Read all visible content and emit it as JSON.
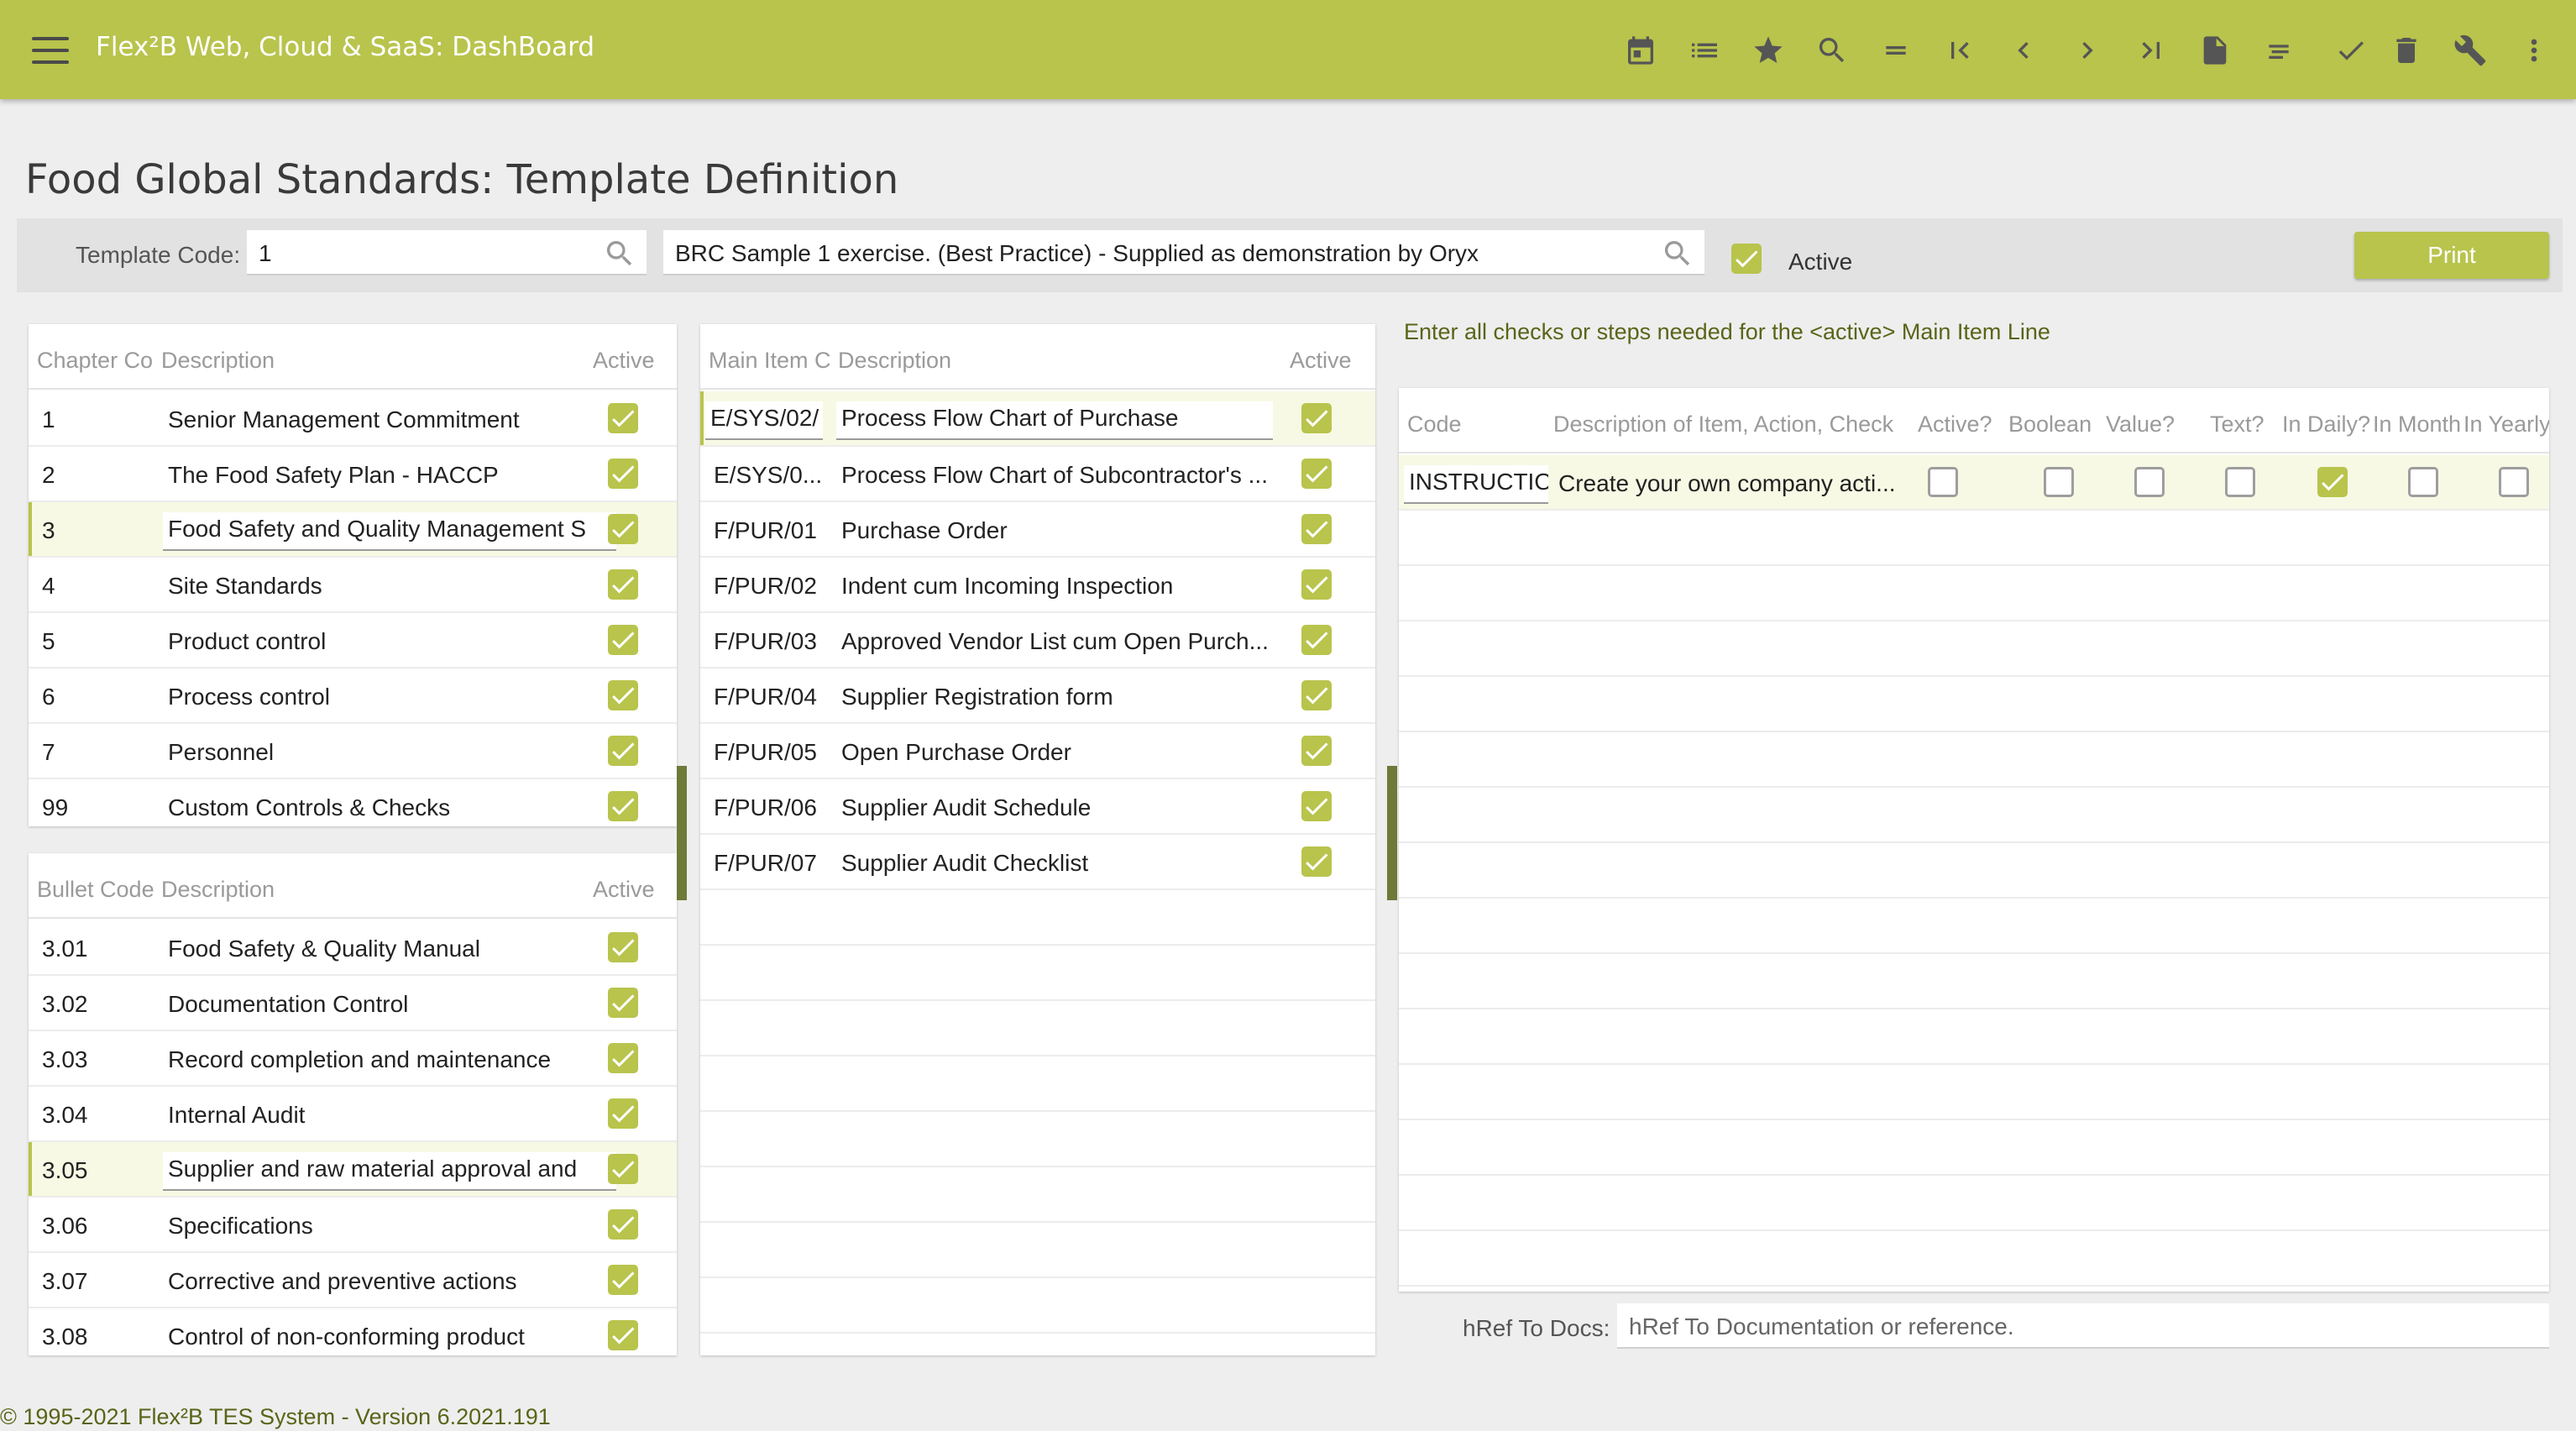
{
  "app": {
    "title": "Flex²B Web, Cloud & SaaS: DashBoard",
    "page_title": "Food Global Standards: Template Definition",
    "footer": "© 1995-2021 Flex²B TES System - Version 6.2021.191",
    "accent_color": "#b8c44c"
  },
  "toolbar": {
    "icons": [
      "calendar-icon",
      "list-icon",
      "star-icon",
      "search-icon",
      "equals-icon",
      "first-page-icon",
      "previous-icon",
      "next-icon",
      "last-page-icon",
      "document-icon",
      "notes-icon",
      "check-icon",
      "delete-icon",
      "wrench-icon",
      "more-vert-icon"
    ]
  },
  "filter": {
    "template_code_label": "Template Code:",
    "template_code_value": "1",
    "description_value": "BRC Sample 1 exercise. (Best Practice) - Supplied as demonstration by Oryx",
    "active_label": "Active",
    "active_checked": true,
    "print_label": "Print"
  },
  "chapters": {
    "headers": {
      "code": "Chapter Co",
      "desc": "Description",
      "active": "Active"
    },
    "rows": [
      {
        "code": "1",
        "desc": "Senior Management Commitment",
        "active": true
      },
      {
        "code": "2",
        "desc": "The Food Safety Plan - HACCP",
        "active": true
      },
      {
        "code": "3",
        "desc": "Food Safety and Quality Management S",
        "active": true,
        "selected": true
      },
      {
        "code": "4",
        "desc": "Site Standards",
        "active": true
      },
      {
        "code": "5",
        "desc": "Product control",
        "active": true
      },
      {
        "code": "6",
        "desc": "Process control",
        "active": true
      },
      {
        "code": "7",
        "desc": "Personnel",
        "active": true
      },
      {
        "code": "99",
        "desc": "Custom Controls & Checks",
        "active": true
      }
    ]
  },
  "bullets": {
    "headers": {
      "code": "Bullet Code",
      "desc": "Description",
      "active": "Active"
    },
    "rows": [
      {
        "code": "3.01",
        "desc": "Food Safety & Quality Manual",
        "active": true
      },
      {
        "code": "3.02",
        "desc": "Documentation Control",
        "active": true
      },
      {
        "code": "3.03",
        "desc": "Record completion and maintenance",
        "active": true
      },
      {
        "code": "3.04",
        "desc": "Internal Audit",
        "active": true
      },
      {
        "code": "3.05",
        "desc": "Supplier and raw material approval and",
        "active": true,
        "selected": true
      },
      {
        "code": "3.06",
        "desc": "Specifications",
        "active": true
      },
      {
        "code": "3.07",
        "desc": "Corrective and preventive actions",
        "active": true
      },
      {
        "code": "3.08",
        "desc": "Control of non-conforming product",
        "active": true
      }
    ]
  },
  "main_items": {
    "headers": {
      "code": "Main Item C",
      "desc": "Description",
      "active": "Active"
    },
    "rows": [
      {
        "code": "E/SYS/02/",
        "desc": "Process Flow Chart of Purchase",
        "active": true,
        "selected": true
      },
      {
        "code": "E/SYS/0...",
        "desc": "Process Flow Chart of Subcontractor's ...",
        "active": true
      },
      {
        "code": "F/PUR/01",
        "desc": "Purchase Order",
        "active": true
      },
      {
        "code": "F/PUR/02",
        "desc": "Indent cum Incoming Inspection",
        "active": true
      },
      {
        "code": "F/PUR/03",
        "desc": "Approved Vendor List cum Open Purch...",
        "active": true
      },
      {
        "code": "F/PUR/04",
        "desc": "Supplier Registration form",
        "active": true
      },
      {
        "code": "F/PUR/05",
        "desc": "Open Purchase Order",
        "active": true
      },
      {
        "code": "F/PUR/06",
        "desc": "Supplier Audit Schedule",
        "active": true
      },
      {
        "code": "F/PUR/07",
        "desc": "Supplier Audit Checklist",
        "active": true
      }
    ]
  },
  "checks": {
    "hint": "Enter all checks or steps needed for the <active> Main Item Line",
    "headers": {
      "code": "Code",
      "desc": "Description of Item, Action, Check",
      "active": "Active?",
      "boolean": "Boolean",
      "value": "Value?",
      "text": "Text?",
      "daily": "In Daily?",
      "monthly": "In Monthly",
      "yearly": "In Yearly"
    },
    "rows": [
      {
        "code": "INSTRUCTIO",
        "desc": "Create your own company acti...",
        "active": false,
        "boolean": false,
        "value": false,
        "text": false,
        "daily": true,
        "monthly": false,
        "yearly": false
      }
    ],
    "href_label": "hRef To Docs:",
    "href_placeholder": "hRef To Documentation or reference."
  }
}
